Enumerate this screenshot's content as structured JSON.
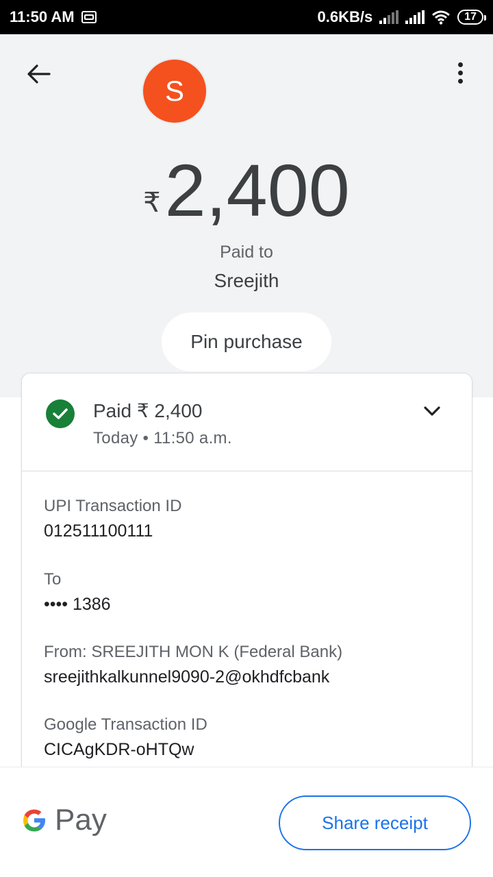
{
  "status_bar": {
    "time": "11:50 AM",
    "net_speed": "0.6KB/s",
    "battery": "17"
  },
  "header": {
    "avatar_letter": "S",
    "currency": "₹",
    "amount": "2,400",
    "paid_to_label": "Paid to",
    "payee": "Sreejith",
    "pin_label": "Pin purchase"
  },
  "summary": {
    "title": "Paid ₹ 2,400",
    "subtitle": "Today • 11:50 a.m."
  },
  "details": [
    {
      "label": "UPI Transaction ID",
      "value": "012511100111"
    },
    {
      "label": "To",
      "value": "•••• 1386"
    },
    {
      "label": "From: SREEJITH MON K (Federal Bank)",
      "value": "sreejithkalkunnel9090-2@okhdfcbank"
    },
    {
      "label": "Google Transaction ID",
      "value": "CICAgKDR-oHTQw"
    }
  ],
  "footer": {
    "brand": "Pay",
    "share_label": "Share receipt"
  },
  "colors": {
    "avatar": "#f4511e",
    "success": "#188038",
    "accent": "#1a73e8"
  },
  "icons": [
    "back-arrow-icon",
    "more-vert-icon",
    "check-circle-icon",
    "chevron-down-icon",
    "google-g-icon"
  ]
}
